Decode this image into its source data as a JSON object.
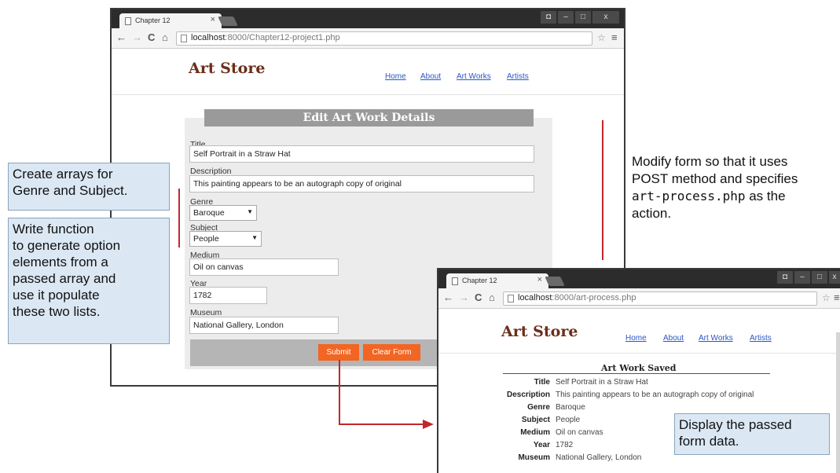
{
  "browser_main": {
    "tab_title": "Chapter 12",
    "tab_close": "×",
    "url_host": "localhost",
    "url_path": ":8000/Chapter12-project1.php"
  },
  "browser_result": {
    "tab_title": "Chapter 12",
    "tab_close": "×",
    "url_host": "localhost",
    "url_path": ":8000/art-process.php"
  },
  "site": {
    "logo": "Art Store",
    "nav": [
      "Home",
      "About",
      "Art Works",
      "Artists"
    ]
  },
  "form": {
    "heading": "Edit Art Work Details",
    "fields": {
      "title": {
        "label": "Title",
        "value": "Self Portrait in a Straw Hat"
      },
      "description": {
        "label": "Description",
        "value": "This painting appears to be an autograph copy of original"
      },
      "genre": {
        "label": "Genre",
        "value": "Baroque"
      },
      "subject": {
        "label": "Subject",
        "value": "People"
      },
      "medium": {
        "label": "Medium",
        "value": "Oil on canvas"
      },
      "year": {
        "label": "Year",
        "value": "1782"
      },
      "museum": {
        "label": "Museum",
        "value": "National Gallery, London"
      }
    },
    "submit_label": "Submit",
    "clear_label": "Clear Form"
  },
  "result": {
    "heading": "Art Work Saved",
    "rows": [
      {
        "key": "Title",
        "value": "Self Portrait in a Straw Hat"
      },
      {
        "key": "Description",
        "value": "This painting appears to be an autograph copy of original"
      },
      {
        "key": "Genre",
        "value": "Baroque"
      },
      {
        "key": "Subject",
        "value": "People"
      },
      {
        "key": "Medium",
        "value": "Oil on canvas"
      },
      {
        "key": "Year",
        "value": "1782"
      },
      {
        "key": "Museum",
        "value": "National Gallery, London"
      }
    ]
  },
  "annotations": {
    "arrays_note": [
      "Create arrays for",
      "Genre and Subject."
    ],
    "function_note": [
      "Write function",
      "to generate option",
      "elements from a",
      "passed array and",
      "use it populate",
      "these two lists."
    ],
    "modify_note": {
      "line1": "Modify form so that it uses",
      "line2": "POST method and specifies",
      "code": "art-process.php",
      "line3_suffix": " as the",
      "line4": "action."
    },
    "display_note": [
      "Display the passed",
      "form data."
    ]
  },
  "colors": {
    "accent_orange": "#f26522",
    "logo_brown": "#6b2e1a",
    "annotation_red": "#c1272d",
    "note_fill": "#dbe8f4"
  }
}
